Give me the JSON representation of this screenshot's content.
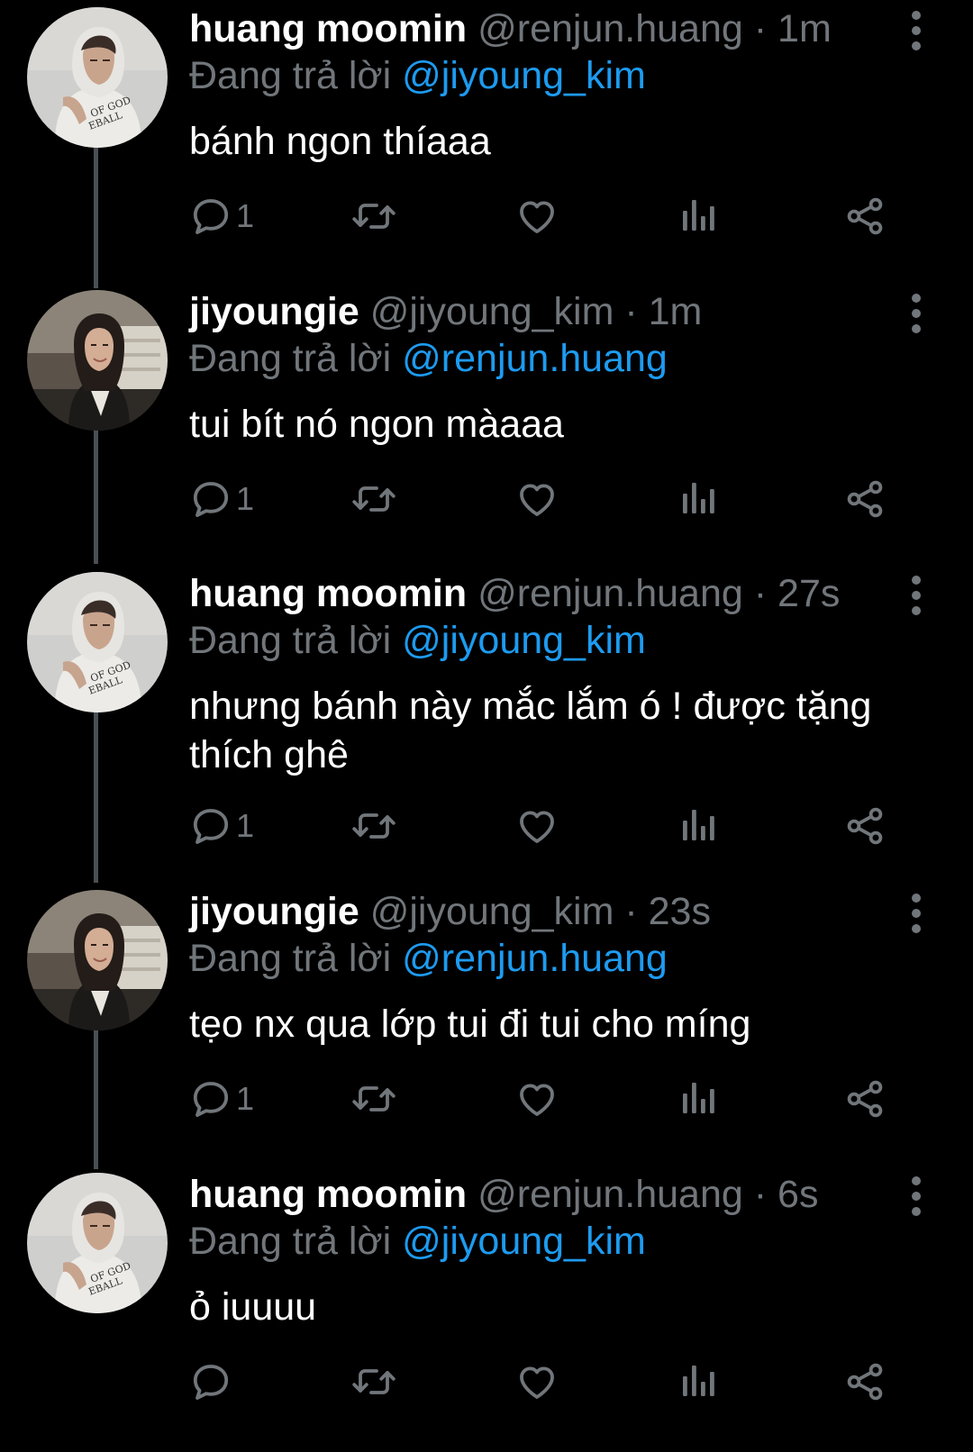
{
  "colors": {
    "background": "#000000",
    "text_primary": "#ffffff",
    "text_secondary": "#71767b",
    "mention": "#1d9bf0",
    "thread_line": "#4a4f55"
  },
  "icons": {
    "more": "more-vertical-icon",
    "reply": "reply-icon",
    "retweet": "retweet-icon",
    "like": "heart-icon",
    "views": "views-icon",
    "share": "share-icon"
  },
  "tweets": [
    {
      "display_name": "huang moomin",
      "handle": "@renjun.huang",
      "separator": "·",
      "time": "1m",
      "reply_prefix": "Đang trả lời",
      "reply_to": "@jiyoung_kim",
      "text": "bánh ngon thíaaa",
      "reply_count": "1",
      "avatar": "avatar-hoodie"
    },
    {
      "display_name": "jiyoungie",
      "handle": "@jiyoung_kim",
      "separator": "·",
      "time": "1m",
      "reply_prefix": "Đang trả lời",
      "reply_to": "@renjun.huang",
      "text": "tui bít nó ngon màaaa",
      "reply_count": "1",
      "avatar": "avatar-girl"
    },
    {
      "display_name": "huang moomin",
      "handle": "@renjun.huang",
      "separator": "·",
      "time": "27s",
      "reply_prefix": "Đang trả lời",
      "reply_to": "@jiyoung_kim",
      "text": "nhưng bánh này mắc lắm ó ! được tặng thích ghê",
      "reply_count": "1",
      "avatar": "avatar-hoodie"
    },
    {
      "display_name": "jiyoungie",
      "handle": "@jiyoung_kim",
      "separator": "·",
      "time": "23s",
      "reply_prefix": "Đang trả lời",
      "reply_to": "@renjun.huang",
      "text": "tẹo nx qua lớp tui đi tui cho míng",
      "reply_count": "1",
      "avatar": "avatar-girl"
    },
    {
      "display_name": "huang moomin",
      "handle": "@renjun.huang",
      "separator": "·",
      "time": "6s",
      "reply_prefix": "Đang trả lời",
      "reply_to": "@jiyoung_kim",
      "text": "ỏ iuuuu",
      "reply_count": "",
      "avatar": "avatar-hoodie"
    }
  ]
}
